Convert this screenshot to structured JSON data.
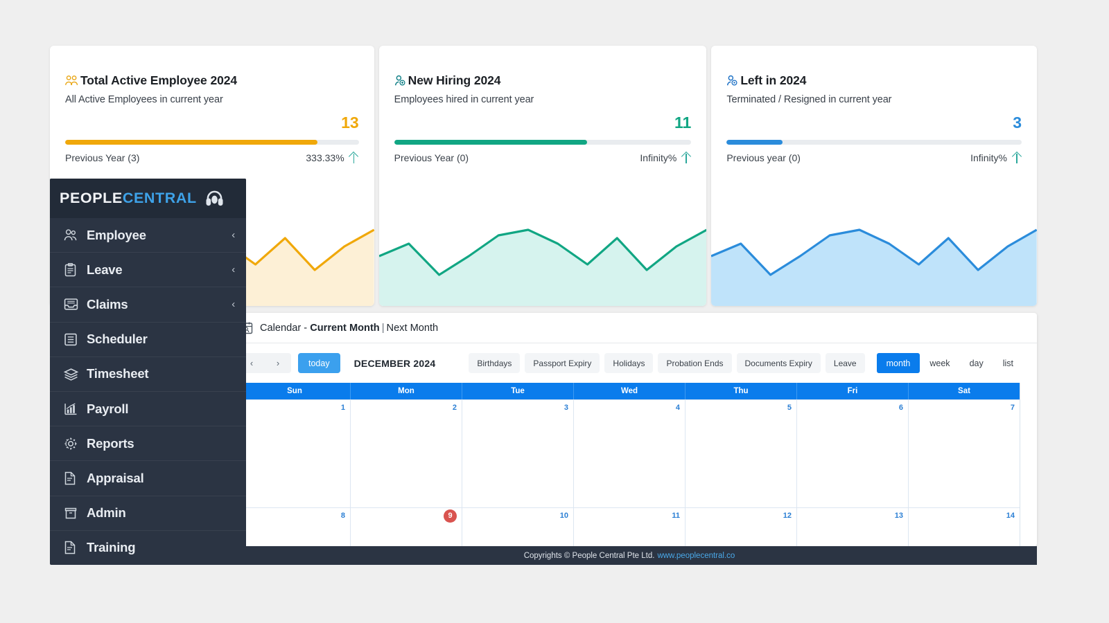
{
  "kpi_cards": [
    {
      "icon": "two-users-icon",
      "title": "Total Active Employee 2024",
      "subtitle": "All Active Employees in current year",
      "value": "13",
      "previous": "Previous Year (3)",
      "percent": "333.33%",
      "trend_icon": "arrow-up-icon",
      "accent": "#f0a80a",
      "fill": "#fdf0d6",
      "bar_percent": 86
    },
    {
      "icon": "user-add-icon",
      "title": "New Hiring 2024",
      "subtitle": "Employees hired in current year",
      "value": "11",
      "previous": "Previous Year (0)",
      "percent": "Infinity%",
      "trend_icon": "arrow-up-icon",
      "accent": "#11a683",
      "fill": "#d6f3ee",
      "bar_percent": 65
    },
    {
      "icon": "user-remove-icon",
      "title": "Left in 2024",
      "subtitle": "Terminated / Resigned in current year",
      "value": "3",
      "previous": "Previous year (0)",
      "percent": "Infinity%",
      "trend_icon": "arrow-up-icon",
      "accent": "#2b8cdb",
      "fill": "#bfe3fa",
      "bar_percent": 19
    }
  ],
  "chart_data": [
    {
      "type": "area",
      "title": "Total Active Employee 2024",
      "x": [
        0,
        1,
        2,
        3,
        4,
        5,
        6,
        7,
        8,
        9,
        10,
        11
      ],
      "values": [
        48,
        62,
        28,
        48,
        70,
        76,
        62,
        38,
        66,
        30,
        56,
        74
      ],
      "line_color": "#f0a80a",
      "fill_color": "#fdf0d6",
      "grid": false,
      "legend": "none",
      "xlabel": "",
      "ylabel": ""
    },
    {
      "type": "area",
      "title": "New Hiring 2024",
      "x": [
        0,
        1,
        2,
        3,
        4,
        5,
        6,
        7,
        8,
        9,
        10,
        11
      ],
      "values": [
        48,
        62,
        28,
        48,
        70,
        76,
        62,
        38,
        66,
        30,
        56,
        74
      ],
      "line_color": "#11a683",
      "fill_color": "#d6f3ee",
      "grid": false,
      "legend": "none",
      "xlabel": "",
      "ylabel": ""
    },
    {
      "type": "area",
      "title": "Left in 2024",
      "x": [
        0,
        1,
        2,
        3,
        4,
        5,
        6,
        7,
        8,
        9,
        10,
        11
      ],
      "values": [
        48,
        62,
        28,
        48,
        70,
        76,
        62,
        38,
        66,
        30,
        56,
        74
      ],
      "line_color": "#2b8cdb",
      "fill_color": "#bfe3fa",
      "grid": false,
      "legend": "none",
      "xlabel": "",
      "ylabel": ""
    }
  ],
  "sidebar": {
    "brand_part1": "PEOPLE",
    "brand_part2": "CENTRAL",
    "brand_icon": "headphones-icon",
    "items": [
      {
        "label": "Employee",
        "icon": "users-icon",
        "chevron": "‹",
        "has_chevron": true
      },
      {
        "label": "Leave",
        "icon": "clipboard-icon",
        "chevron": "‹",
        "has_chevron": true
      },
      {
        "label": "Claims",
        "icon": "inbox-icon",
        "chevron": "‹",
        "has_chevron": true
      },
      {
        "label": "Scheduler",
        "icon": "list-icon",
        "chevron": "",
        "has_chevron": false
      },
      {
        "label": "Timesheet",
        "icon": "layers-icon",
        "chevron": "",
        "has_chevron": false
      },
      {
        "label": "Payroll",
        "icon": "chart-icon",
        "chevron": "",
        "has_chevron": false
      },
      {
        "label": "Reports",
        "icon": "gear-icon",
        "chevron": "",
        "has_chevron": false
      },
      {
        "label": "Appraisal",
        "icon": "document-icon",
        "chevron": "",
        "has_chevron": false
      },
      {
        "label": "Admin",
        "icon": "box-icon",
        "chevron": "",
        "has_chevron": false
      },
      {
        "label": "Training",
        "icon": "document-icon",
        "chevron": "",
        "has_chevron": false
      }
    ]
  },
  "calendar": {
    "header_icon": "calendar-icon",
    "header_prefix": "Calendar - ",
    "header_current": "Current Month",
    "header_separator": "|",
    "header_next": "Next Month",
    "prev_label": "‹",
    "next_label": "›",
    "today_label": "today",
    "month_label": "DECEMBER 2024",
    "filters": [
      "Birthdays",
      "Passport Expiry",
      "Holidays",
      "Probation Ends",
      "Documents Expiry",
      "Leave"
    ],
    "views": [
      {
        "label": "month",
        "active": true
      },
      {
        "label": "week",
        "active": false
      },
      {
        "label": "day",
        "active": false
      },
      {
        "label": "list",
        "active": false
      }
    ],
    "day_headers": [
      "Sun",
      "Mon",
      "Tue",
      "Wed",
      "Thu",
      "Fri",
      "Sat"
    ],
    "weeks": [
      {
        "days": [
          "1",
          "2",
          "3",
          "4",
          "5",
          "6",
          "7"
        ],
        "today_index": -1
      },
      {
        "days": [
          "8",
          "9",
          "10",
          "11",
          "12",
          "13",
          "14"
        ],
        "today_index": 1
      }
    ]
  },
  "footer": {
    "text": "Copyrights © People Central Pte Ltd.",
    "link": "www.peoplecentral.co"
  }
}
